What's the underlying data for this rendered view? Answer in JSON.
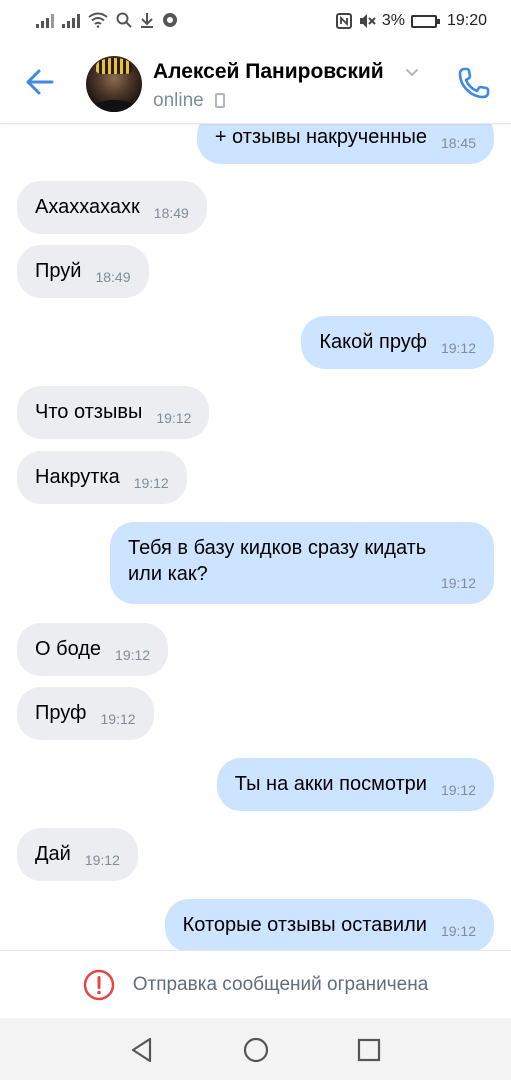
{
  "status_bar": {
    "left_icons": [
      "signal-icon",
      "signal-icon",
      "wifi-icon",
      "search-icon",
      "download-icon",
      "shield-icon"
    ],
    "right_icons": [
      "nfc-icon",
      "mute-icon"
    ],
    "battery_percent": "3%",
    "time": "19:20"
  },
  "header": {
    "contact_name": "Алексей Панировский",
    "status": "online",
    "accent_color": "#3f8ae0"
  },
  "messages": [
    {
      "dir": "out",
      "text": "+ отзывы накрученные",
      "time": "18:45"
    },
    {
      "dir": "in",
      "text": "Ахаххахахк",
      "time": "18:49"
    },
    {
      "dir": "in",
      "text": "Пруй",
      "time": "18:49"
    },
    {
      "dir": "out",
      "text": "Какой пруф",
      "time": "19:12"
    },
    {
      "dir": "in",
      "text": "Что отзывы",
      "time": "19:12"
    },
    {
      "dir": "in",
      "text": "Накрутка",
      "time": "19:12"
    },
    {
      "dir": "out",
      "text": "Тебя в базу кидков сразу кидать\nили как?",
      "time": "19:12"
    },
    {
      "dir": "in",
      "text": "О боде",
      "time": "19:12"
    },
    {
      "dir": "in",
      "text": "Пруф",
      "time": "19:12"
    },
    {
      "dir": "out",
      "text": "Ты на акки посмотри",
      "time": "19:12"
    },
    {
      "dir": "in",
      "text": "Дай",
      "time": "19:12"
    },
    {
      "dir": "out",
      "text": "Которые отзывы оставили",
      "time": "19:12"
    }
  ],
  "restriction": {
    "text": "Отправка сообщений ограничена",
    "icon": "warning-icon",
    "icon_color": "#e64646"
  },
  "nav": {
    "icons": [
      "back-triangle-icon",
      "home-circle-icon",
      "recents-square-icon"
    ]
  }
}
